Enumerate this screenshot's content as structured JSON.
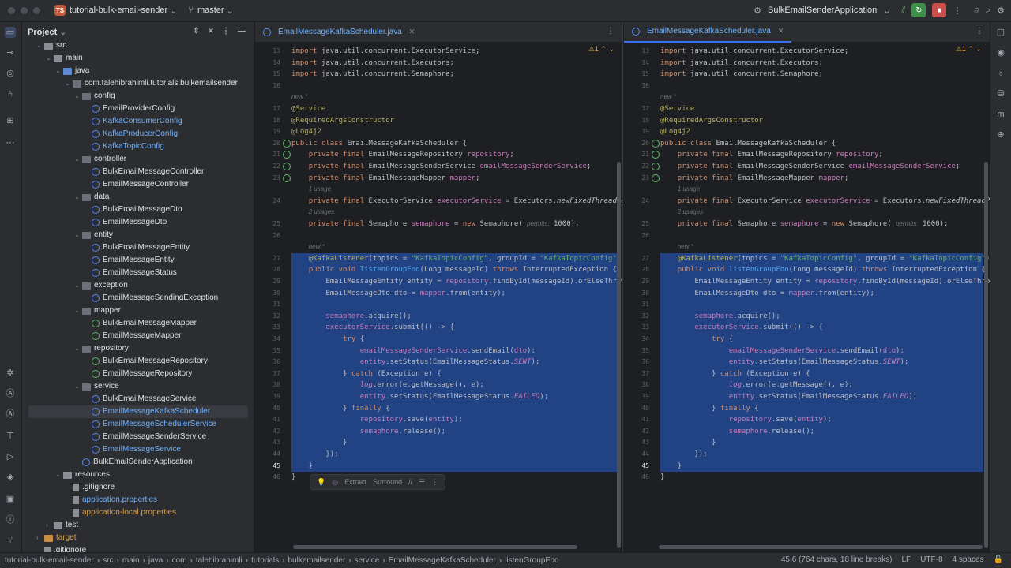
{
  "titlebar": {
    "project_badge": "TS",
    "project_name": "tutorial-bulk-email-sender",
    "branch": "master",
    "run_config": "BulkEmailSenderApplication"
  },
  "project_panel": {
    "title": "Project",
    "tree": [
      {
        "label": "src",
        "depth": 0,
        "kind": "folder",
        "arrow": "down"
      },
      {
        "label": "main",
        "depth": 1,
        "kind": "folder",
        "arrow": "down"
      },
      {
        "label": "java",
        "depth": 2,
        "kind": "folder-blue",
        "arrow": "down"
      },
      {
        "label": "com.talehibrahimli.tutorials.bulkemailsender",
        "depth": 3,
        "kind": "package",
        "arrow": "down"
      },
      {
        "label": "config",
        "depth": 4,
        "kind": "package",
        "arrow": "down"
      },
      {
        "label": "EmailProviderConfig",
        "depth": 5,
        "kind": "class"
      },
      {
        "label": "KafkaConsumerConfig",
        "depth": 5,
        "kind": "class",
        "color": "#6fb1ff"
      },
      {
        "label": "KafkaProducerConfig",
        "depth": 5,
        "kind": "class",
        "color": "#6fb1ff"
      },
      {
        "label": "KafkaTopicConfig",
        "depth": 5,
        "kind": "class",
        "color": "#6fb1ff"
      },
      {
        "label": "controller",
        "depth": 4,
        "kind": "package",
        "arrow": "down"
      },
      {
        "label": "BulkEmailMessageController",
        "depth": 5,
        "kind": "class"
      },
      {
        "label": "EmailMessageController",
        "depth": 5,
        "kind": "class"
      },
      {
        "label": "data",
        "depth": 4,
        "kind": "package",
        "arrow": "down"
      },
      {
        "label": "BulkEmailMessageDto",
        "depth": 5,
        "kind": "class"
      },
      {
        "label": "EmailMessageDto",
        "depth": 5,
        "kind": "class"
      },
      {
        "label": "entity",
        "depth": 4,
        "kind": "package",
        "arrow": "down"
      },
      {
        "label": "BulkEmailMessageEntity",
        "depth": 5,
        "kind": "class"
      },
      {
        "label": "EmailMessageEntity",
        "depth": 5,
        "kind": "class"
      },
      {
        "label": "EmailMessageStatus",
        "depth": 5,
        "kind": "class"
      },
      {
        "label": "exception",
        "depth": 4,
        "kind": "package",
        "arrow": "down"
      },
      {
        "label": "EmailMessageSendingException",
        "depth": 5,
        "kind": "class"
      },
      {
        "label": "mapper",
        "depth": 4,
        "kind": "package",
        "arrow": "down"
      },
      {
        "label": "BulkEmailMessageMapper",
        "depth": 5,
        "kind": "interface"
      },
      {
        "label": "EmailMessageMapper",
        "depth": 5,
        "kind": "interface"
      },
      {
        "label": "repository",
        "depth": 4,
        "kind": "package",
        "arrow": "down"
      },
      {
        "label": "BulkEmailMessageRepository",
        "depth": 5,
        "kind": "interface"
      },
      {
        "label": "EmailMessageRepository",
        "depth": 5,
        "kind": "interface"
      },
      {
        "label": "service",
        "depth": 4,
        "kind": "package",
        "arrow": "down"
      },
      {
        "label": "BulkEmailMessageService",
        "depth": 5,
        "kind": "class"
      },
      {
        "label": "EmailMessageKafkaScheduler",
        "depth": 5,
        "kind": "class",
        "color": "#6fb1ff",
        "selected": true
      },
      {
        "label": "EmailMessageSchedulerService",
        "depth": 5,
        "kind": "class",
        "color": "#6fb1ff"
      },
      {
        "label": "EmailMessageSenderService",
        "depth": 5,
        "kind": "class"
      },
      {
        "label": "EmailMessageService",
        "depth": 5,
        "kind": "class",
        "color": "#6fb1ff"
      },
      {
        "label": "BulkEmailSenderApplication",
        "depth": 4,
        "kind": "class"
      },
      {
        "label": "resources",
        "depth": 2,
        "kind": "folder",
        "arrow": "down"
      },
      {
        "label": ".gitignore",
        "depth": 3,
        "kind": "file"
      },
      {
        "label": "application.properties",
        "depth": 3,
        "kind": "file",
        "color": "#6fb1ff"
      },
      {
        "label": "application-local.properties",
        "depth": 3,
        "kind": "file",
        "color": "#d6a14f"
      },
      {
        "label": "test",
        "depth": 1,
        "kind": "folder",
        "arrow": "right"
      },
      {
        "label": "target",
        "depth": 0,
        "kind": "folder-orange",
        "arrow": "right",
        "color": "#d6a14f"
      },
      {
        "label": ".gitignore",
        "depth": 0,
        "kind": "file"
      }
    ]
  },
  "editors": [
    {
      "tab": "EmailMessageKafkaScheduler.java",
      "warn": "1"
    },
    {
      "tab": "EmailMessageKafkaScheduler.java",
      "warn": "1"
    }
  ],
  "code": [
    {
      "n": "13",
      "html": "<span class='kw'>import</span> java.util.concurrent.ExecutorService;"
    },
    {
      "n": "14",
      "html": "<span class='kw'>import</span> java.util.concurrent.Executors;"
    },
    {
      "n": "15",
      "html": "<span class='kw'>import</span> java.util.concurrent.Semaphore;"
    },
    {
      "n": "16",
      "html": ""
    },
    {
      "n": "",
      "html": "<span class='hint'>new *</span>"
    },
    {
      "n": "17",
      "html": "<span class='an'>@Service</span>"
    },
    {
      "n": "18",
      "html": "<span class='an'>@RequiredArgsConstructor</span>"
    },
    {
      "n": "19",
      "html": "<span class='an'>@Log4j2</span>"
    },
    {
      "n": "20",
      "html": "<span class='kw'>public class</span> EmailMessageKafkaScheduler {"
    },
    {
      "n": "21",
      "html": "    <span class='kw'>private final</span> EmailMessageRepository <span class='fd'>repository</span>;"
    },
    {
      "n": "22",
      "html": "    <span class='kw'>private final</span> EmailMessageSenderService <span class='fd'>emailMessageSenderService</span>;"
    },
    {
      "n": "23",
      "html": "    <span class='kw'>private final</span> EmailMessageMapper <span class='fd'>mapper</span>;"
    },
    {
      "n": "",
      "html": "    <span class='hint'>1 usage</span>"
    },
    {
      "n": "24",
      "html": "    <span class='kw'>private final</span> ExecutorService <span class='fd'>executorService</span> = Executors.<span class='it'>newFixedThreadPool</span>("
    },
    {
      "n": "",
      "html": "    <span class='hint'>2 usages</span>"
    },
    {
      "n": "25",
      "html": "    <span class='kw'>private final</span> Semaphore <span class='fd'>semaphore</span> = <span class='kw'>new</span> Semaphore( <span class='hint'>permits:</span> 1000);"
    },
    {
      "n": "26",
      "html": ""
    },
    {
      "n": "",
      "html": "    <span class='hint'>new *</span>"
    },
    {
      "n": "27",
      "html": "    <span class='an'>@KafkaListener</span>(topics = <span class='st'>\"KafkaTopicConfig\"</span>, groupId = <span class='st'>\"KafkaTopicConfig\"</span>)"
    },
    {
      "n": "28",
      "html": "    <span class='kw'>public void</span> <span class='mt'>listenGroupFoo</span>(Long messageId) <span class='kw'>throws</span> InterruptedException {"
    },
    {
      "n": "29",
      "html": "        EmailMessageEntity entity = <span class='fd'>repository</span>.findById(messageId).orElseThrow();"
    },
    {
      "n": "30",
      "html": "        EmailMessageDto dto = <span class='fd'>mapper</span>.from(entity);"
    },
    {
      "n": "31",
      "html": ""
    },
    {
      "n": "32",
      "html": "        <span class='fd'>semaphore</span>.acquire();"
    },
    {
      "n": "33",
      "html": "        <span class='fd'>executorService</span>.submit(() -> {"
    },
    {
      "n": "34",
      "html": "            <span class='kw'>try</span> {"
    },
    {
      "n": "35",
      "html": "                <span class='fd'>emailMessageSenderService</span>.sendEmail(<span class='fd'>dto</span>);"
    },
    {
      "n": "36",
      "html": "                <span class='fd'>entity</span>.setStatus(EmailMessageStatus.<span class='fd it'>SENT</span>);"
    },
    {
      "n": "37",
      "html": "            } <span class='kw'>catch</span> (Exception e) {"
    },
    {
      "n": "38",
      "html": "                <span class='fd it'>log</span>.error(e.getMessage(), e);"
    },
    {
      "n": "39",
      "html": "                <span class='fd'>entity</span>.setStatus(EmailMessageStatus.<span class='fd it'>FAILED</span>);"
    },
    {
      "n": "40",
      "html": "            } <span class='kw'>finally</span> {"
    },
    {
      "n": "41",
      "html": "                <span class='fd'>repository</span>.save(<span class='fd'>entity</span>);"
    },
    {
      "n": "42",
      "html": "                <span class='fd'>semaphore</span>.release();"
    },
    {
      "n": "43",
      "html": "            }"
    },
    {
      "n": "44",
      "html": "        });"
    },
    {
      "n": "45",
      "html": "    }"
    },
    {
      "n": "46",
      "html": "}"
    }
  ],
  "floating_toolbar": {
    "extract": "Extract",
    "surround": "Surround"
  },
  "statusbar": {
    "crumbs": [
      "tutorial-bulk-email-sender",
      "src",
      "main",
      "java",
      "com",
      "talehibrahimli",
      "tutorials",
      "bulkemailsender",
      "service",
      "EmailMessageKafkaScheduler",
      "listenGroupFoo"
    ],
    "position": "45:6 (764 chars, 18 line breaks)",
    "line_sep": "LF",
    "encoding": "UTF-8",
    "indent": "4 spaces"
  }
}
